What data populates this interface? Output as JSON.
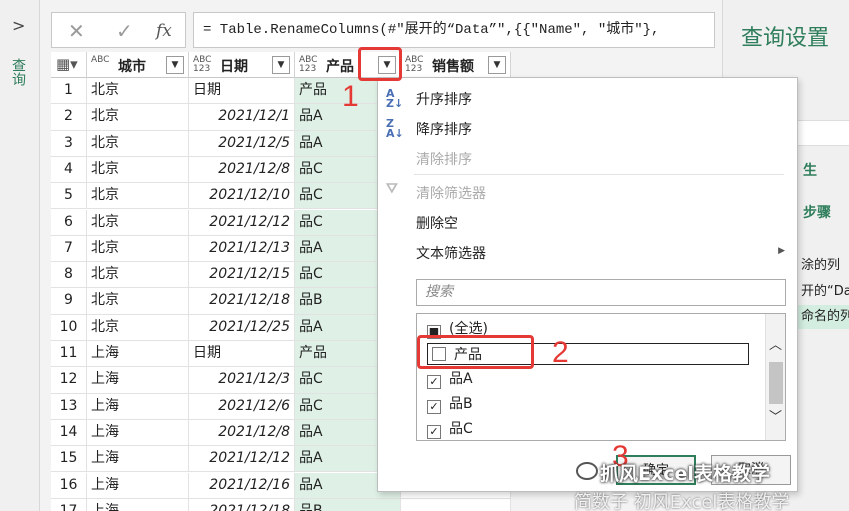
{
  "left_pane": {
    "chevron": ">",
    "label": "查询"
  },
  "formula_bar": {
    "cancel_glyph": "✕",
    "confirm_glyph": "✓",
    "fx_glyph": "fx",
    "formula": "= Table.RenameColumns(#\"展开的“Data”\",{{\"Name\", \"城市\"},"
  },
  "settings": {
    "title": "查询设置",
    "section_props": "生",
    "section_steps": "步骤",
    "steps": [
      "涂的列",
      "开的“Dat",
      "命名的列"
    ]
  },
  "grid": {
    "columns": [
      {
        "type": "ABC",
        "type2": "",
        "name": "城市"
      },
      {
        "type": "ABC",
        "type2": "123",
        "name": "日期"
      },
      {
        "type": "ABC",
        "type2": "123",
        "name": "产品"
      },
      {
        "type": "ABC",
        "type2": "123",
        "name": "销售额"
      }
    ],
    "rows": [
      [
        "1",
        "北京",
        "日期",
        "产品"
      ],
      [
        "2",
        "北京",
        "2021/12/1",
        "品A"
      ],
      [
        "3",
        "北京",
        "2021/12/5",
        "品A"
      ],
      [
        "4",
        "北京",
        "2021/12/8",
        "品C"
      ],
      [
        "5",
        "北京",
        "2021/12/10",
        "品C"
      ],
      [
        "6",
        "北京",
        "2021/12/12",
        "品C"
      ],
      [
        "7",
        "北京",
        "2021/12/13",
        "品A"
      ],
      [
        "8",
        "北京",
        "2021/12/15",
        "品C"
      ],
      [
        "9",
        "北京",
        "2021/12/18",
        "品B"
      ],
      [
        "10",
        "北京",
        "2021/12/25",
        "品A"
      ],
      [
        "11",
        "上海",
        "日期",
        "产品"
      ],
      [
        "12",
        "上海",
        "2021/12/3",
        "品C"
      ],
      [
        "13",
        "上海",
        "2021/12/6",
        "品C"
      ],
      [
        "14",
        "上海",
        "2021/12/8",
        "品A"
      ],
      [
        "15",
        "上海",
        "2021/12/12",
        "品A"
      ],
      [
        "16",
        "上海",
        "2021/12/16",
        "品A"
      ],
      [
        "17",
        "上海",
        "2021/12/18",
        "品B"
      ]
    ]
  },
  "menu": {
    "sort_asc": "升序排序",
    "sort_desc": "降序排序",
    "clear_sort": "清除排序",
    "clear_filter": "清除筛选器",
    "remove_empty": "删除空",
    "text_filters": "文本筛选器",
    "search_placeholder": "搜索",
    "items": [
      {
        "label": "(全选)",
        "state": "partial"
      },
      {
        "label": "产品",
        "state": "unchecked"
      },
      {
        "label": "品A",
        "state": "checked"
      },
      {
        "label": "品B",
        "state": "checked"
      },
      {
        "label": "品C",
        "state": "checked"
      }
    ],
    "ok": "确定",
    "cancel": "取消"
  },
  "annotations": [
    "1",
    "2",
    "3"
  ],
  "watermark": {
    "line1": "抓风Excel表格教学",
    "line2": "简数子 初风Excel表格教学"
  }
}
